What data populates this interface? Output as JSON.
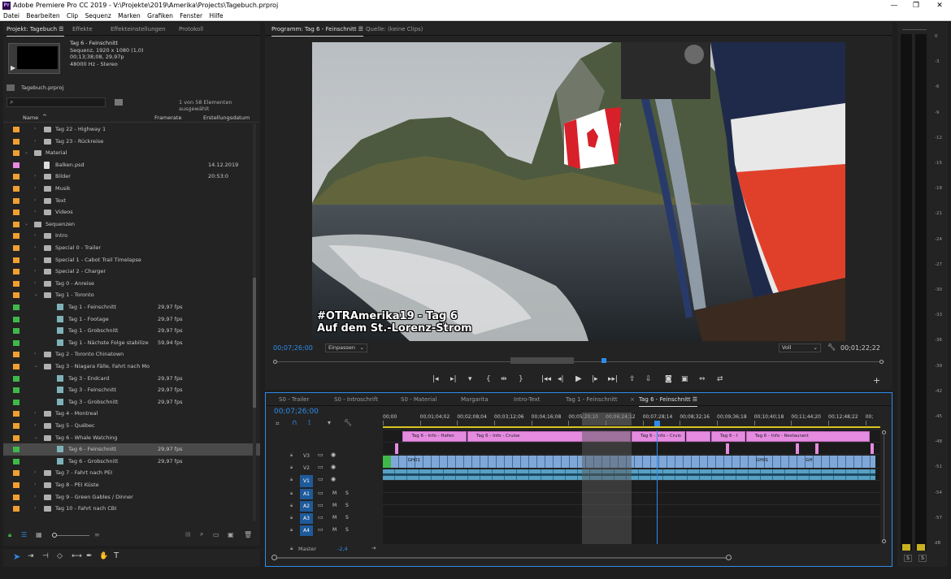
{
  "window": {
    "title": "Adobe Premiere Pro CC 2019 - V:\\Projekte\\2019\\Amerika\\Projects\\Tagebuch.prproj",
    "app_icon": "Pr",
    "minimize": "—",
    "maximize": "❐",
    "close": "✕"
  },
  "menu": [
    "Datei",
    "Bearbeiten",
    "Clip",
    "Sequenz",
    "Marken",
    "Grafiken",
    "Fenster",
    "Hilfe"
  ],
  "project_panel": {
    "tabs": [
      "Projekt: Tagebuch ☰",
      "Effekte",
      "Effekteinstellungen",
      "Protokoll"
    ],
    "preview": {
      "name": "Tag 6 - Feinschnitt",
      "line1": "Sequenz, 1920 x 1080 (1,0)",
      "line2": "00;13;38;08, 29,97p",
      "line3": "48000 Hz - Stereo"
    },
    "project_file": "Tagebuch.prproj",
    "count": "1 von 58 Elementen ausgewählt",
    "columns": {
      "name": "Name",
      "framerate": "Framerate",
      "date": "Erstellungsdatum"
    },
    "rows": [
      {
        "name": "Tag 22 - Highway 1",
        "color": "#f0a030",
        "indent": 1,
        "type": "folder",
        "fr": "",
        "dt": "",
        "arrow": "›"
      },
      {
        "name": "Tag 23 - Rückreise",
        "color": "#f0a030",
        "indent": 1,
        "type": "folder",
        "fr": "",
        "dt": "",
        "arrow": "›"
      },
      {
        "name": "Material",
        "color": "#f0a030",
        "indent": 0,
        "type": "folder",
        "fr": "",
        "dt": "",
        "arrow": "⌄"
      },
      {
        "name": "Balken.psd",
        "color": "#e58be0",
        "indent": 1,
        "type": "file",
        "fr": "",
        "dt": "14.12.2019 20:53:0",
        "arrow": ""
      },
      {
        "name": "Bilder",
        "color": "#f0a030",
        "indent": 1,
        "type": "folder",
        "fr": "",
        "dt": "",
        "arrow": "›"
      },
      {
        "name": "Musik",
        "color": "#f0a030",
        "indent": 1,
        "type": "folder",
        "fr": "",
        "dt": "",
        "arrow": "›"
      },
      {
        "name": "Text",
        "color": "#f0a030",
        "indent": 1,
        "type": "folder",
        "fr": "",
        "dt": "",
        "arrow": "›"
      },
      {
        "name": "Videos",
        "color": "#f0a030",
        "indent": 1,
        "type": "folder",
        "fr": "",
        "dt": "",
        "arrow": "›"
      },
      {
        "name": "Sequenzen",
        "color": "#f0a030",
        "indent": 0,
        "type": "folder",
        "fr": "",
        "dt": "",
        "arrow": "⌄"
      },
      {
        "name": "Intro",
        "color": "#f0a030",
        "indent": 1,
        "type": "folder",
        "fr": "",
        "dt": "",
        "arrow": "›"
      },
      {
        "name": "Special 0 - Trailer",
        "color": "#f0a030",
        "indent": 1,
        "type": "folder",
        "fr": "",
        "dt": "",
        "arrow": "›"
      },
      {
        "name": "Special 1 - Cabot Trail Timelapse",
        "color": "#f0a030",
        "indent": 1,
        "type": "folder",
        "fr": "",
        "dt": "",
        "arrow": "›"
      },
      {
        "name": "Special 2 - Charger",
        "color": "#f0a030",
        "indent": 1,
        "type": "folder",
        "fr": "",
        "dt": "",
        "arrow": "›"
      },
      {
        "name": "Tag 0 - Anreise",
        "color": "#f0a030",
        "indent": 1,
        "type": "folder",
        "fr": "",
        "dt": "",
        "arrow": "›"
      },
      {
        "name": "Tag 1 - Toronto",
        "color": "#f0a030",
        "indent": 1,
        "type": "folder",
        "fr": "",
        "dt": "",
        "arrow": "⌄"
      },
      {
        "name": "Tag 1 - Feinschnitt",
        "color": "#3fb84a",
        "indent": 2,
        "type": "seq",
        "fr": "29,97 fps",
        "dt": "",
        "arrow": ""
      },
      {
        "name": "Tag 1 - Footage",
        "color": "#3fb84a",
        "indent": 2,
        "type": "seq",
        "fr": "29,97 fps",
        "dt": "",
        "arrow": ""
      },
      {
        "name": "Tag 1 - Grobschnitt",
        "color": "#3fb84a",
        "indent": 2,
        "type": "seq",
        "fr": "29,97 fps",
        "dt": "",
        "arrow": ""
      },
      {
        "name": "Tag 1 - Nächste Folge stabilize",
        "color": "#3fb84a",
        "indent": 2,
        "type": "seq",
        "fr": "59,94 fps",
        "dt": "",
        "arrow": ""
      },
      {
        "name": "Tag 2 - Toronto Chinatown",
        "color": "#f0a030",
        "indent": 1,
        "type": "folder",
        "fr": "",
        "dt": "",
        "arrow": "›"
      },
      {
        "name": "Tag 3 - Niagara Fälle, Fahrt nach Mo",
        "color": "#f0a030",
        "indent": 1,
        "type": "folder",
        "fr": "",
        "dt": "",
        "arrow": "⌄"
      },
      {
        "name": "Tag 3 - Endcard",
        "color": "#3fb84a",
        "indent": 2,
        "type": "seq",
        "fr": "29,97 fps",
        "dt": "",
        "arrow": ""
      },
      {
        "name": "Tag 3 - Feinschnitt",
        "color": "#3fb84a",
        "indent": 2,
        "type": "seq",
        "fr": "29,97 fps",
        "dt": "",
        "arrow": ""
      },
      {
        "name": "Tag 3 - Grobschnitt",
        "color": "#3fb84a",
        "indent": 2,
        "type": "seq",
        "fr": "29,97 fps",
        "dt": "",
        "arrow": ""
      },
      {
        "name": "Tag 4 - Montreal",
        "color": "#f0a030",
        "indent": 1,
        "type": "folder",
        "fr": "",
        "dt": "",
        "arrow": "›"
      },
      {
        "name": "Tag 5 - Québec",
        "color": "#f0a030",
        "indent": 1,
        "type": "folder",
        "fr": "",
        "dt": "",
        "arrow": "›"
      },
      {
        "name": "Tag 6 - Whale Watching",
        "color": "#f0a030",
        "indent": 1,
        "type": "folder",
        "fr": "",
        "dt": "",
        "arrow": "⌄"
      },
      {
        "name": "Tag 6 - Feinschnitt",
        "color": "#3fb84a",
        "indent": 2,
        "type": "seq",
        "fr": "29,97 fps",
        "dt": "",
        "arrow": "",
        "selected": true
      },
      {
        "name": "Tag 6 - Grobschnitt",
        "color": "#3fb84a",
        "indent": 2,
        "type": "seq",
        "fr": "29,97 fps",
        "dt": "",
        "arrow": ""
      },
      {
        "name": "Tag 7 - Fahrt nach PEI",
        "color": "#f0a030",
        "indent": 1,
        "type": "folder",
        "fr": "",
        "dt": "",
        "arrow": "›"
      },
      {
        "name": "Tag 8 - PEI Küste",
        "color": "#f0a030",
        "indent": 1,
        "type": "folder",
        "fr": "",
        "dt": "",
        "arrow": "›"
      },
      {
        "name": "Tag 9 - Green Gables / Dinner",
        "color": "#f0a030",
        "indent": 1,
        "type": "folder",
        "fr": "",
        "dt": "",
        "arrow": "›"
      },
      {
        "name": "Tag 10 - Fahrt nach CBI",
        "color": "#f0a030",
        "indent": 1,
        "type": "folder",
        "fr": "",
        "dt": "",
        "arrow": "›"
      }
    ]
  },
  "program_monitor": {
    "tabs": [
      "Programm: Tag 6 - Feinschnitt ☰",
      "Quelle: (keine Clips)"
    ],
    "overlay_line1": "#OTRAmerika19 - Tag 6",
    "overlay_line2": "Auf dem St.-Lorenz-Strom",
    "timecode": "00;07;26;00",
    "fit": "Einpassen",
    "quality": "Voll",
    "duration": "00;01;22;22"
  },
  "timeline": {
    "tabs": [
      "S0 - Trailer",
      "S0 - Introschrift",
      "S0 - Material",
      "Margarita",
      "Intro-Text",
      "Tag 1 - Feinschnitt",
      "Tag 6 - Feinschnitt ☰"
    ],
    "timecode": "00;07;26;00",
    "ruler": [
      "00;00",
      "00;01;04;02",
      "00;02;08;04",
      "00;03;12;06",
      "00;04;16;08",
      "00;05;20;10",
      "00;06;24;12",
      "00;07;28;14",
      "00;08;32;16",
      "00;09;36;18",
      "00;10;40;18",
      "00;11;44;20",
      "00;12;48;22",
      "00;"
    ],
    "tracks": [
      {
        "label": "V3",
        "kind": "video"
      },
      {
        "label": "V2",
        "kind": "video"
      },
      {
        "label": "V1",
        "kind": "video",
        "active": true
      },
      {
        "label": "A1",
        "kind": "audio",
        "active": true
      },
      {
        "label": "A2",
        "kind": "audio",
        "active": true
      },
      {
        "label": "A3",
        "kind": "audio",
        "active": true
      },
      {
        "label": "A4",
        "kind": "audio",
        "active": true
      }
    ],
    "master_label": "Master",
    "master_value": "-2,4",
    "v3_clips": [
      {
        "label": "Tag 6 - Info - Hafen",
        "start": 0.04,
        "end": 0.17
      },
      {
        "label": "Tag 6 - Info - Cruise",
        "start": 0.17,
        "end": 0.5
      },
      {
        "label": "Tag 6 - Info - Cruis",
        "start": 0.5,
        "end": 0.61
      },
      {
        "label": "",
        "start": 0.61,
        "end": 0.66
      },
      {
        "label": "Tag 6 - I",
        "start": 0.66,
        "end": 0.73
      },
      {
        "label": "Tag 6 - Info - Restaurant",
        "start": 0.73,
        "end": 0.98
      }
    ],
    "v1_labels": [
      {
        "label": "GH01",
        "at": 0.05
      },
      {
        "label": "GH01",
        "at": 0.75
      },
      {
        "label": "GH",
        "at": 0.85
      }
    ],
    "playhead": 0.55,
    "inout_start": 0.4,
    "inout_end": 0.5
  },
  "audio_meter": {
    "scale": [
      "0",
      "-3",
      "-6",
      "-9",
      "-12",
      "-15",
      "-18",
      "-21",
      "-24",
      "-27",
      "-30",
      "-33",
      "-36",
      "-39",
      "-42",
      "-45",
      "-48",
      "-51",
      "-54",
      "-57",
      "dB"
    ],
    "solo": [
      "S",
      "S"
    ]
  },
  "colors": {
    "accent": "#2d8ceb",
    "sequence_green": "#3fb84a",
    "bin_orange": "#f0a030",
    "graphic_pink": "#e58be0",
    "video_clip": "#7fa8d8",
    "audio_clip": "#57a0c4"
  }
}
